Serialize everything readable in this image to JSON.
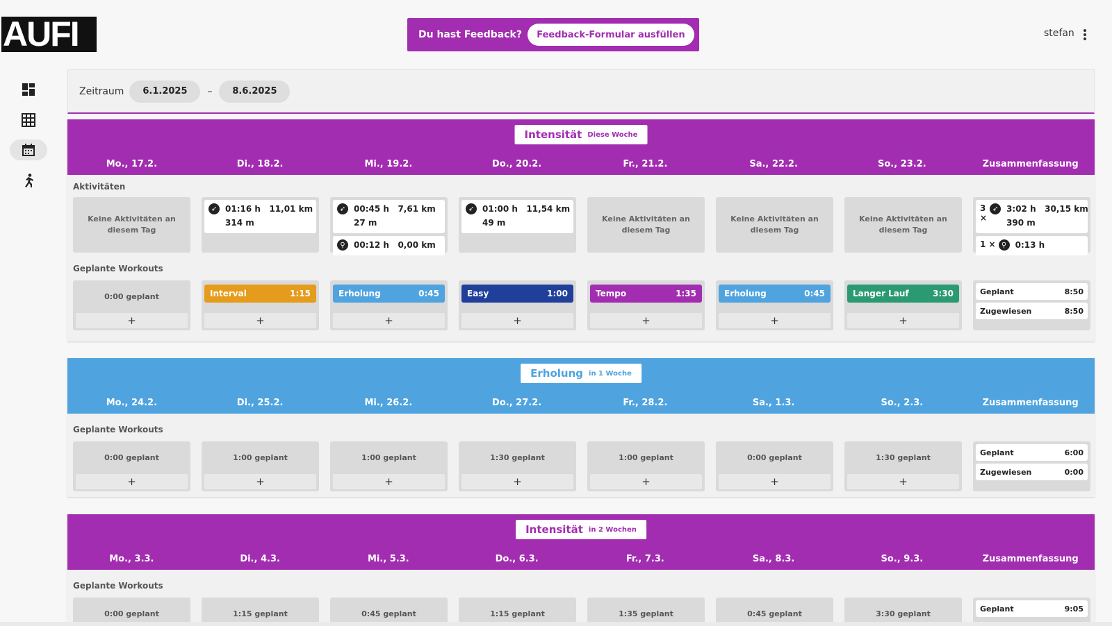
{
  "app": {
    "logo_text": "AUFI",
    "user_name": "stefan"
  },
  "feedback": {
    "text": "Du hast Feedback?",
    "button_label": "Feedback-Formular ausfüllen"
  },
  "sidebar": {
    "items": [
      {
        "name": "dashboard",
        "active": false
      },
      {
        "name": "table",
        "active": false
      },
      {
        "name": "calendar",
        "active": true
      },
      {
        "name": "runner",
        "active": false
      }
    ]
  },
  "period": {
    "label": "Zeitraum",
    "from": "6.1.2025",
    "dash": "–",
    "to": "8.6.2025"
  },
  "colors": {
    "intensity": "#a22db0",
    "recovery": "#4fa3df",
    "interval": "#e59b1b",
    "easy": "#1f3f9b",
    "tempo": "#a22db0",
    "long_run": "#2a9a73",
    "erholung": "#4fa3df"
  },
  "weeks": [
    {
      "title": "Intensität",
      "subtitle": "Diese Woche",
      "color": "#a22db0",
      "days": [
        "Mo., 17.2.",
        "Di., 18.2.",
        "Mi., 19.2.",
        "Do., 20.2.",
        "Fr., 21.2.",
        "Sa., 22.2.",
        "So., 23.2.",
        "Zusammenfassung"
      ],
      "activities_label": "Aktivitäten",
      "workouts_label": "Geplante Workouts",
      "activities": [
        {
          "empty": "Keine Aktivitäten an diesem Tag"
        },
        {
          "cards": [
            {
              "icon": "run-icon",
              "line1": "01:16 h   11,01 km",
              "line2": "314 m"
            }
          ]
        },
        {
          "cards": [
            {
              "icon": "run-icon",
              "line1": "00:45 h   7,61 km",
              "line2": "27 m"
            },
            {
              "icon": "bike-icon",
              "line1": "00:12 h   0,00 km",
              "line2": ""
            }
          ]
        },
        {
          "cards": [
            {
              "icon": "run-icon",
              "line1": "01:00 h   11,54 km",
              "line2": "49 m"
            }
          ]
        },
        {
          "empty": "Keine Aktivitäten an diesem Tag"
        },
        {
          "empty": "Keine Aktivitäten an diesem Tag"
        },
        {
          "empty": "Keine Aktivitäten an diesem Tag"
        },
        {
          "cards": [
            {
              "count": "3 ×",
              "icon": "run-icon",
              "line1": "3:02 h   30,15 km",
              "line2": "390 m"
            },
            {
              "count": "1 ×",
              "icon": "bike-icon",
              "line1": "0:13 h",
              "line2": ""
            }
          ]
        }
      ],
      "workouts": [
        {
          "planned": "0:00 geplant"
        },
        {
          "badge": {
            "name": "Interval",
            "duration": "1:15",
            "color": "#e59b1b"
          }
        },
        {
          "badge": {
            "name": "Erholung",
            "duration": "0:45",
            "color": "#4fa3df"
          }
        },
        {
          "badge": {
            "name": "Easy",
            "duration": "1:00",
            "color": "#1f3f9b"
          }
        },
        {
          "badge": {
            "name": "Tempo",
            "duration": "1:35",
            "color": "#a22db0"
          }
        },
        {
          "badge": {
            "name": "Erholung",
            "duration": "0:45",
            "color": "#4fa3df"
          }
        },
        {
          "badge": {
            "name": "Langer Lauf",
            "duration": "3:30",
            "color": "#2a9a73"
          }
        },
        {
          "summary": [
            {
              "label": "Geplant",
              "value": "8:50"
            },
            {
              "label": "Zugewiesen",
              "value": "8:50"
            }
          ]
        }
      ]
    },
    {
      "title": "Erholung",
      "subtitle": "in 1 Woche",
      "color": "#4fa3df",
      "days": [
        "Mo., 24.2.",
        "Di., 25.2.",
        "Mi., 26.2.",
        "Do., 27.2.",
        "Fr., 28.2.",
        "Sa., 1.3.",
        "So., 2.3.",
        "Zusammenfassung"
      ],
      "workouts_label": "Geplante Workouts",
      "workouts": [
        {
          "planned": "0:00 geplant"
        },
        {
          "planned": "1:00 geplant"
        },
        {
          "planned": "1:00 geplant"
        },
        {
          "planned": "1:30 geplant"
        },
        {
          "planned": "1:00 geplant"
        },
        {
          "planned": "0:00 geplant"
        },
        {
          "planned": "1:30 geplant"
        },
        {
          "summary": [
            {
              "label": "Geplant",
              "value": "6:00"
            },
            {
              "label": "Zugewiesen",
              "value": "0:00"
            }
          ]
        }
      ]
    },
    {
      "title": "Intensität",
      "subtitle": "in 2 Wochen",
      "color": "#a22db0",
      "days": [
        "Mo., 3.3.",
        "Di., 4.3.",
        "Mi., 5.3.",
        "Do., 6.3.",
        "Fr., 7.3.",
        "Sa., 8.3.",
        "So., 9.3.",
        "Zusammenfassung"
      ],
      "workouts_label": "Geplante Workouts",
      "workouts": [
        {
          "planned": "0:00 geplant"
        },
        {
          "planned": "1:15 geplant"
        },
        {
          "planned": "0:45 geplant"
        },
        {
          "planned": "1:15 geplant"
        },
        {
          "planned": "1:35 geplant"
        },
        {
          "planned": "0:45 geplant"
        },
        {
          "planned": "3:30 geplant"
        },
        {
          "summary": [
            {
              "label": "Geplant",
              "value": "9:05"
            }
          ]
        }
      ]
    }
  ],
  "add_symbol": "+"
}
